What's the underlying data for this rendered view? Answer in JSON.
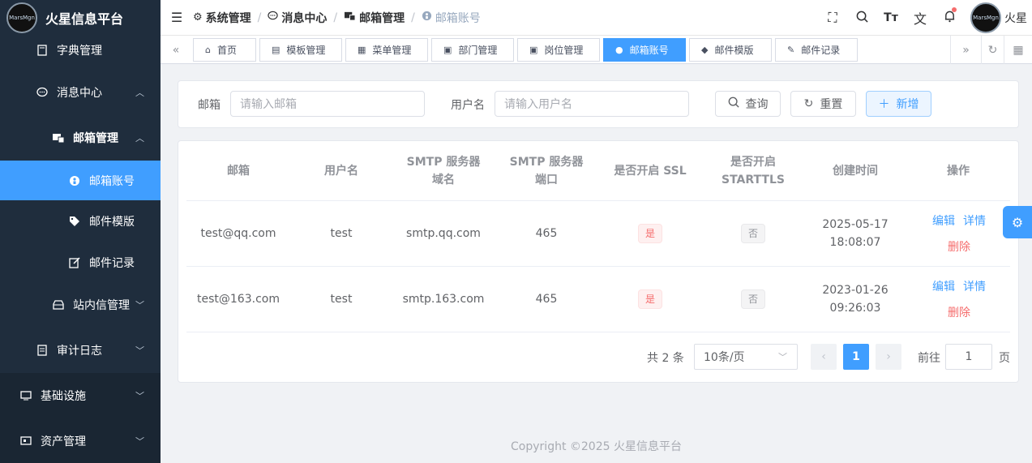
{
  "app": {
    "title": "火星信息平台",
    "logo_text": "MarsMgn"
  },
  "sidebar": {
    "items": [
      {
        "label": "字典管理"
      },
      {
        "label": "消息中心"
      },
      {
        "label": "邮箱管理"
      },
      {
        "label": "邮箱账号"
      },
      {
        "label": "邮件模版"
      },
      {
        "label": "邮件记录"
      },
      {
        "label": "站内信管理"
      },
      {
        "label": "审计日志"
      },
      {
        "label": "基础设施"
      },
      {
        "label": "资产管理"
      }
    ]
  },
  "header": {
    "breadcrumb": [
      "系统管理",
      "消息中心",
      "邮箱管理",
      "邮箱账号"
    ],
    "user": "火星",
    "avatar_text": "MarsMgn"
  },
  "tabs": [
    {
      "label": "首页"
    },
    {
      "label": "模板管理"
    },
    {
      "label": "菜单管理"
    },
    {
      "label": "部门管理"
    },
    {
      "label": "岗位管理"
    },
    {
      "label": "邮箱账号"
    },
    {
      "label": "邮件模版"
    },
    {
      "label": "邮件记录"
    }
  ],
  "search": {
    "email_label": "邮箱",
    "email_placeholder": "请输入邮箱",
    "username_label": "用户名",
    "username_placeholder": "请输入用户名",
    "query_button": "查询",
    "reset_button": "重置",
    "add_button": "新增"
  },
  "table": {
    "headers": [
      "邮箱",
      "用户名",
      "SMTP 服务器域名",
      "SMTP 服务器端口",
      "是否开启 SSL",
      "是否开启 STARTTLS",
      "创建时间",
      "操作"
    ],
    "rows": [
      {
        "email": "test@qq.com",
        "username": "test",
        "host": "smtp.qq.com",
        "port": "465",
        "ssl": "是",
        "starttls": "否",
        "created_date": "2025-05-17",
        "created_time": "18:08:07"
      },
      {
        "email": "test@163.com",
        "username": "test",
        "host": "smtp.163.com",
        "port": "465",
        "ssl": "是",
        "starttls": "否",
        "created_date": "2023-01-26",
        "created_time": "09:26:03"
      }
    ],
    "actions": {
      "edit": "编辑",
      "detail": "详情",
      "delete": "删除"
    }
  },
  "pagination": {
    "total": "共 2 条",
    "page_size": "10条/页",
    "current_page": "1",
    "goto_prefix": "前往",
    "goto_value": "1",
    "goto_suffix": "页"
  },
  "footer": {
    "text": "Copyright ©2025 火星信息平台"
  },
  "colors": {
    "primary": "#409eff",
    "sidebar_bg": "#1f2d3d",
    "danger": "#f56c6c"
  }
}
